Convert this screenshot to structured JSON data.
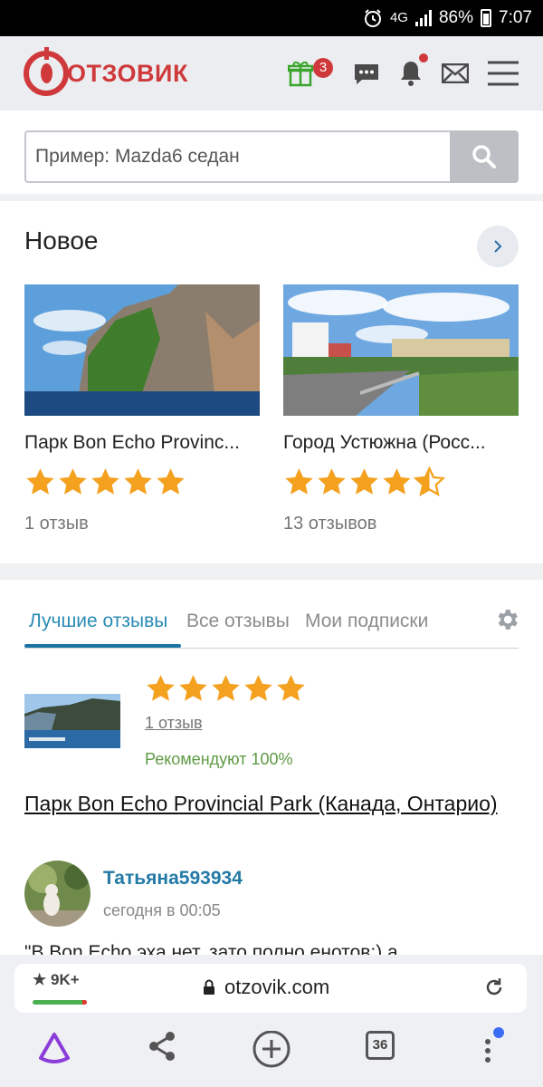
{
  "status": {
    "time": "7:07",
    "battery": "86%",
    "network": "4G"
  },
  "header": {
    "logo_text": "ОТЗОВИК",
    "gift_badge": "3"
  },
  "search": {
    "placeholder": "Пример: Mazda6 седан"
  },
  "new_section": {
    "title": "Новое",
    "items": [
      {
        "name": "Парк Bon Echo Provinc...",
        "rating": 5,
        "count": "1 отзыв"
      },
      {
        "name": "Город Устюжна (Росс...",
        "rating": 4.5,
        "count": "13 отзывов"
      }
    ]
  },
  "tabs": [
    {
      "label": "Лучшие отзывы"
    },
    {
      "label": "Все отзывы"
    },
    {
      "label": "Мои подписки"
    }
  ],
  "review": {
    "rating": 5,
    "count": "1 отзыв",
    "recommend": "Рекомендуют 100%",
    "title": "Парк Bon Echo Provincial Park (Канада, Онтарио)",
    "author": "Татьяна593934",
    "date": "сегодня в 00:05",
    "excerpt": "\"В Bon Echo эха нет, зато полно енотов:) а"
  },
  "browser": {
    "rating": "9K+",
    "domain": "otzovik.com",
    "tab_count": "36"
  },
  "colors": {
    "brand": "#d0393b",
    "star": "#f4a11f",
    "link": "#237aa5",
    "recommend": "#5e9a44"
  }
}
